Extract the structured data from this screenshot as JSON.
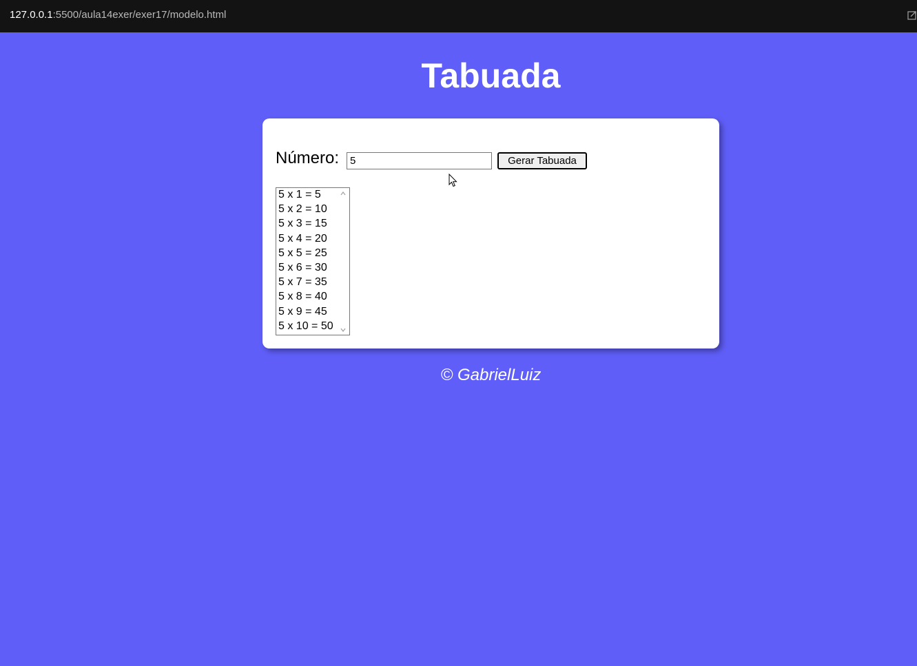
{
  "browser": {
    "url_host": "127.0.0.1",
    "url_rest": ":5500/aula14exer/exer17/modelo.html",
    "share_icon": "share-icon"
  },
  "page": {
    "background": "#5f5ef8",
    "title": "Tabuada"
  },
  "form": {
    "number_label": "Número:",
    "number_value": "5",
    "generate_button": "Gerar Tabuada"
  },
  "table_list": {
    "items": [
      "5 x 1 = 5",
      "5 x 2 = 10",
      "5 x 3 = 15",
      "5 x 4 = 20",
      "5 x 5 = 25",
      "5 x 6 = 30",
      "5 x 7 = 35",
      "5 x 8 = 40",
      "5 x 9 = 45",
      "5 x 10 = 50"
    ]
  },
  "footer": {
    "text": "© GabrielLuiz"
  }
}
